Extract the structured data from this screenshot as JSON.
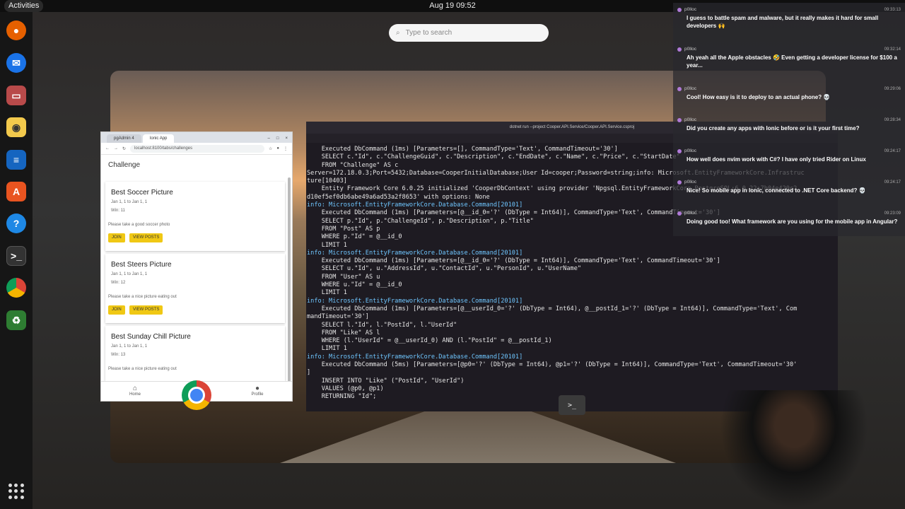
{
  "topbar": {
    "activities": "Activities",
    "clock": "Aug 19  09:52"
  },
  "dock": {
    "items": [
      "firefox-icon",
      "thunderbird-icon",
      "files-icon",
      "rhythmbox-icon",
      "writer-icon",
      "software-icon",
      "help-icon",
      "terminal-icon",
      "chrome-icon",
      "trash-icon"
    ],
    "colors": [
      "#e66000",
      "#1a73e8",
      "#b84a4a",
      "#f2c94c",
      "#1565c0",
      "#e95420",
      "#1e88e5",
      "#333333",
      "#4285f4",
      "#2e7d32"
    ]
  },
  "search": {
    "placeholder": "Type to search"
  },
  "browser": {
    "tabs": [
      "pgAdmin 4",
      "Ionic App"
    ],
    "url": "localhost:8100/tabs/challenges",
    "page_title": "Challenge",
    "cards": [
      {
        "title": "Best Soccer Picture",
        "dates": "Jan 1, 1 to Jan 1, 1",
        "wins": "Win: 11",
        "desc": "Please take a good soccer photo",
        "join": "JOIN",
        "view": "VIEW POSTS"
      },
      {
        "title": "Best Steers Picture",
        "dates": "Jan 1, 1 to Jan 1, 1",
        "wins": "Win: 12",
        "desc": "Please take a nice picture eating out",
        "join": "JOIN",
        "view": "VIEW POSTS"
      },
      {
        "title": "Best Sunday Chill Picture",
        "dates": "Jan 1, 1 to Jan 1, 1",
        "wins": "Win: 13",
        "desc": "Please take a nice picture eating out"
      }
    ],
    "tabbar": {
      "home": "Home",
      "profile": "Profile"
    }
  },
  "terminal": {
    "title": "dotnet run --project Cooper.API.Service/Cooper.API.Service.csproj",
    "lines": [
      {
        "c": "",
        "t": "    Executed DbCommand (1ms) [Parameters=[], CommandType='Text', CommandTimeout='30']"
      },
      {
        "c": "",
        "t": "    SELECT c.\"Id\", c.\"ChallengeGuid\", c.\"Description\", c.\"EndDate\", c.\"Name\", c.\"Price\", c.\"StartDate\""
      },
      {
        "c": "",
        "t": "    FROM \"Challenge\" AS c"
      },
      {
        "c": "",
        "t": "Server=172.18.0.3;Port=5432;Database=CooperInitialDatabase;User Id=cooper;Password=string;info: Microsoft.EntityFrameworkCore.Infrastruc"
      },
      {
        "c": "",
        "t": "ture[10403]"
      },
      {
        "c": "",
        "t": "    Entity Framework Core 6.0.25 initialized 'CooperDbContext' using provider 'Npgsql.EntityFrameworkCore.PostgreSQL:6.0.22+7b04e420c2"
      },
      {
        "c": "",
        "t": "d10ef5ef0db6abe49a6ad53a2f8653' with options: None"
      },
      {
        "c": "info",
        "t": "info: Microsoft.EntityFrameworkCore.Database.Command[20101]"
      },
      {
        "c": "",
        "t": "    Executed DbCommand (1ms) [Parameters=[@__id_0='?' (DbType = Int64)], CommandType='Text', CommandTimeout='30']"
      },
      {
        "c": "",
        "t": "    SELECT p.\"Id\", p.\"ChallengeId\", p.\"Description\", p.\"Title\""
      },
      {
        "c": "",
        "t": "    FROM \"Post\" AS p"
      },
      {
        "c": "",
        "t": "    WHERE p.\"Id\" = @__id_0"
      },
      {
        "c": "",
        "t": "    LIMIT 1"
      },
      {
        "c": "info",
        "t": "info: Microsoft.EntityFrameworkCore.Database.Command[20101]"
      },
      {
        "c": "",
        "t": "    Executed DbCommand (1ms) [Parameters=[@__id_0='?' (DbType = Int64)], CommandType='Text', CommandTimeout='30']"
      },
      {
        "c": "",
        "t": "    SELECT u.\"Id\", u.\"AddressId\", u.\"ContactId\", u.\"PersonId\", u.\"UserName\""
      },
      {
        "c": "",
        "t": "    FROM \"User\" AS u"
      },
      {
        "c": "",
        "t": "    WHERE u.\"Id\" = @__id_0"
      },
      {
        "c": "",
        "t": "    LIMIT 1"
      },
      {
        "c": "info",
        "t": "info: Microsoft.EntityFrameworkCore.Database.Command[20101]"
      },
      {
        "c": "",
        "t": "    Executed DbCommand (1ms) [Parameters=[@__userId_0='?' (DbType = Int64), @__postId_1='?' (DbType = Int64)], CommandType='Text', Com"
      },
      {
        "c": "",
        "t": "mandTimeout='30']"
      },
      {
        "c": "",
        "t": "    SELECT l.\"Id\", l.\"PostId\", l.\"UserId\""
      },
      {
        "c": "",
        "t": "    FROM \"Like\" AS l"
      },
      {
        "c": "",
        "t": "    WHERE (l.\"UserId\" = @__userId_0) AND (l.\"PostId\" = @__postId_1)"
      },
      {
        "c": "",
        "t": "    LIMIT 1"
      },
      {
        "c": "info",
        "t": "info: Microsoft.EntityFrameworkCore.Database.Command[20101]"
      },
      {
        "c": "",
        "t": "    Executed DbCommand (5ms) [Parameters=[@p0='?' (DbType = Int64), @p1='?' (DbType = Int64)], CommandType='Text', CommandTimeout='30'"
      },
      {
        "c": "",
        "t": "]"
      },
      {
        "c": "",
        "t": "    INSERT INTO \"Like\" (\"PostId\", \"UserId\")"
      },
      {
        "c": "",
        "t": "    VALUES (@p0, @p1)"
      },
      {
        "c": "",
        "t": "    RETURNING \"Id\";"
      }
    ],
    "button": ">_"
  },
  "chat": {
    "messages": [
      {
        "user": "p0lloc",
        "time": "09:33:13",
        "text": "I guess to battle spam and malware, but it really makes it hard for small developers 🙌"
      },
      {
        "user": "p0lloc",
        "time": "09:32:14",
        "text": "Ah yeah all the Apple obstacles 🤣 Even getting a developer license for $100 a year..."
      },
      {
        "user": "p0lloc",
        "time": "09:29:06",
        "text": "Cool! How easy is it to deploy to an actual phone? 💀"
      },
      {
        "user": "p0lloc",
        "time": "09:28:34",
        "text": "Did you create any apps with Ionic before or is it your first time?"
      },
      {
        "user": "p0lloc",
        "time": "09:24:17",
        "text": "How well does nvim work with C#? I have only tried Rider on Linux"
      },
      {
        "user": "p0lloc",
        "time": "09:24:17",
        "text": "Nice! So mobile app in Ionic, connected to .NET Core backend? 💀"
      },
      {
        "user": "p0lloc",
        "time": "09:23:09",
        "text": "Doing good too! What framework are you using for the mobile app in Angular?"
      }
    ]
  }
}
